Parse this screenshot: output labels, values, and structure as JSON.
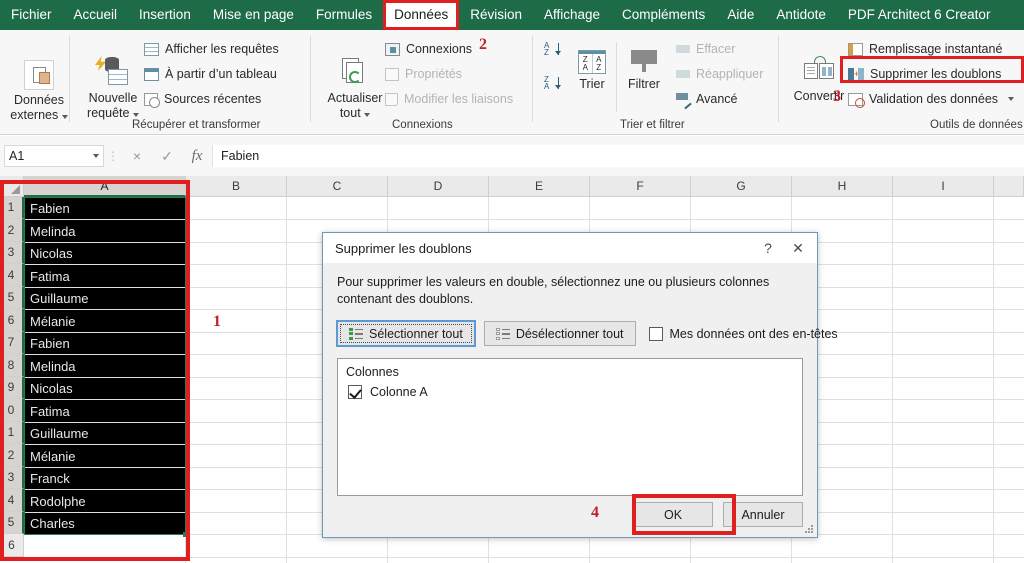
{
  "ribbon_tabs": [
    {
      "label": "Fichier",
      "active": false
    },
    {
      "label": "Accueil",
      "active": false
    },
    {
      "label": "Insertion",
      "active": false
    },
    {
      "label": "Mise en page",
      "active": false
    },
    {
      "label": "Formules",
      "active": false
    },
    {
      "label": "Données",
      "active": true
    },
    {
      "label": "Révision",
      "active": false
    },
    {
      "label": "Affichage",
      "active": false
    },
    {
      "label": "Compléments",
      "active": false
    },
    {
      "label": "Aide",
      "active": false
    },
    {
      "label": "Antidote",
      "active": false
    },
    {
      "label": "PDF Architect 6 Creator",
      "active": false
    }
  ],
  "ribbon": {
    "groups": [
      {
        "label": "Récupérer et transformer"
      },
      {
        "label": "Connexions"
      },
      {
        "label": "Trier et filtrer"
      },
      {
        "label": "Outils de données"
      }
    ],
    "external_data": {
      "line1": "Données",
      "line2": "externes"
    },
    "new_query": {
      "line1": "Nouvelle",
      "line2": "requête"
    },
    "get_transform_items": [
      {
        "label": "Afficher les requêtes",
        "icon": "table-grid-icon",
        "disabled": false
      },
      {
        "label": "À partir d’un tableau",
        "icon": "table-header-icon",
        "disabled": false
      },
      {
        "label": "Sources récentes",
        "icon": "recent-clock-icon",
        "disabled": false
      }
    ],
    "refresh_all": {
      "line1": "Actualiser",
      "line2": "tout"
    },
    "connection_items": [
      {
        "label": "Connexions",
        "icon": "connections-icon",
        "disabled": false
      },
      {
        "label": "Propriétés",
        "icon": "properties-icon",
        "disabled": true
      },
      {
        "label": "Modifier les liaisons",
        "icon": "edit-links-icon",
        "disabled": true
      }
    ],
    "sort_label": "Trier",
    "filter_label": "Filtrer",
    "sort_az": {
      "top": "A",
      "bottom": "Z"
    },
    "sort_za": {
      "top": "Z",
      "bottom": "A"
    },
    "sort_big": {
      "left_top": "Z",
      "left_bottom": "A",
      "right_top": "A",
      "right_bottom": "Z"
    },
    "filter_items": [
      {
        "label": "Effacer",
        "icon": "clear-filter-icon",
        "disabled": true
      },
      {
        "label": "Réappliquer",
        "icon": "reapply-filter-icon",
        "disabled": true
      },
      {
        "label": "Avancé",
        "icon": "advanced-filter-icon",
        "disabled": false
      }
    ],
    "convert_label": "Convertir",
    "data_tools_items": [
      {
        "label": "Remplissage instantané",
        "icon": "flash-fill-icon",
        "disabled": false
      },
      {
        "label": "Supprimer les doublons",
        "icon": "remove-duplicates-icon",
        "disabled": false
      },
      {
        "label": "Validation des données",
        "icon": "data-validation-icon",
        "disabled": false
      }
    ]
  },
  "markers": {
    "m1": "1",
    "m2": "2",
    "m3": "3",
    "m4": "4"
  },
  "formula_bar": {
    "name_box_value": "A1",
    "cancel_icon": "×",
    "confirm_icon": "✓",
    "fx_icon": "fx",
    "content": "Fabien"
  },
  "sheet": {
    "column_headers": [
      "A",
      "B",
      "C",
      "D",
      "E",
      "F",
      "G",
      "H",
      "I"
    ],
    "selected_column": "A",
    "row_numbers": [
      "1",
      "2",
      "3",
      "4",
      "5",
      "6",
      "7",
      "8",
      "9",
      "0",
      "1",
      "2",
      "3",
      "4",
      "5",
      "6"
    ],
    "column_a_values": [
      "Fabien",
      "Melinda",
      "Nicolas",
      "Fatima",
      "Guillaume",
      "Mélanie",
      "Fabien",
      "Melinda",
      "Nicolas",
      "Fatima",
      "Guillaume",
      "Mélanie",
      "Franck",
      "Rodolphe",
      "Charles"
    ]
  },
  "dialog": {
    "title": "Supprimer les doublons",
    "help_icon": "?",
    "close_icon": "✕",
    "description": "Pour supprimer les valeurs en double, sélectionnez une ou plusieurs colonnes contenant des doublons.",
    "select_all_label": "Sélectionner tout",
    "deselect_all_label": "Désélectionner tout",
    "headers_checkbox_label": "Mes données ont des en-têtes",
    "headers_checkbox_checked": false,
    "list_header": "Colonnes",
    "list_items": [
      {
        "label": "Colonne A",
        "checked": true
      }
    ],
    "ok_label": "OK",
    "cancel_label": "Annuler"
  },
  "colors": {
    "ribbon_green": "#1e6b47",
    "highlight_red": "#e02020",
    "marker_red": "#c0202a",
    "selection_green": "#2b7a52",
    "dialog_border": "#6a9ab8"
  }
}
